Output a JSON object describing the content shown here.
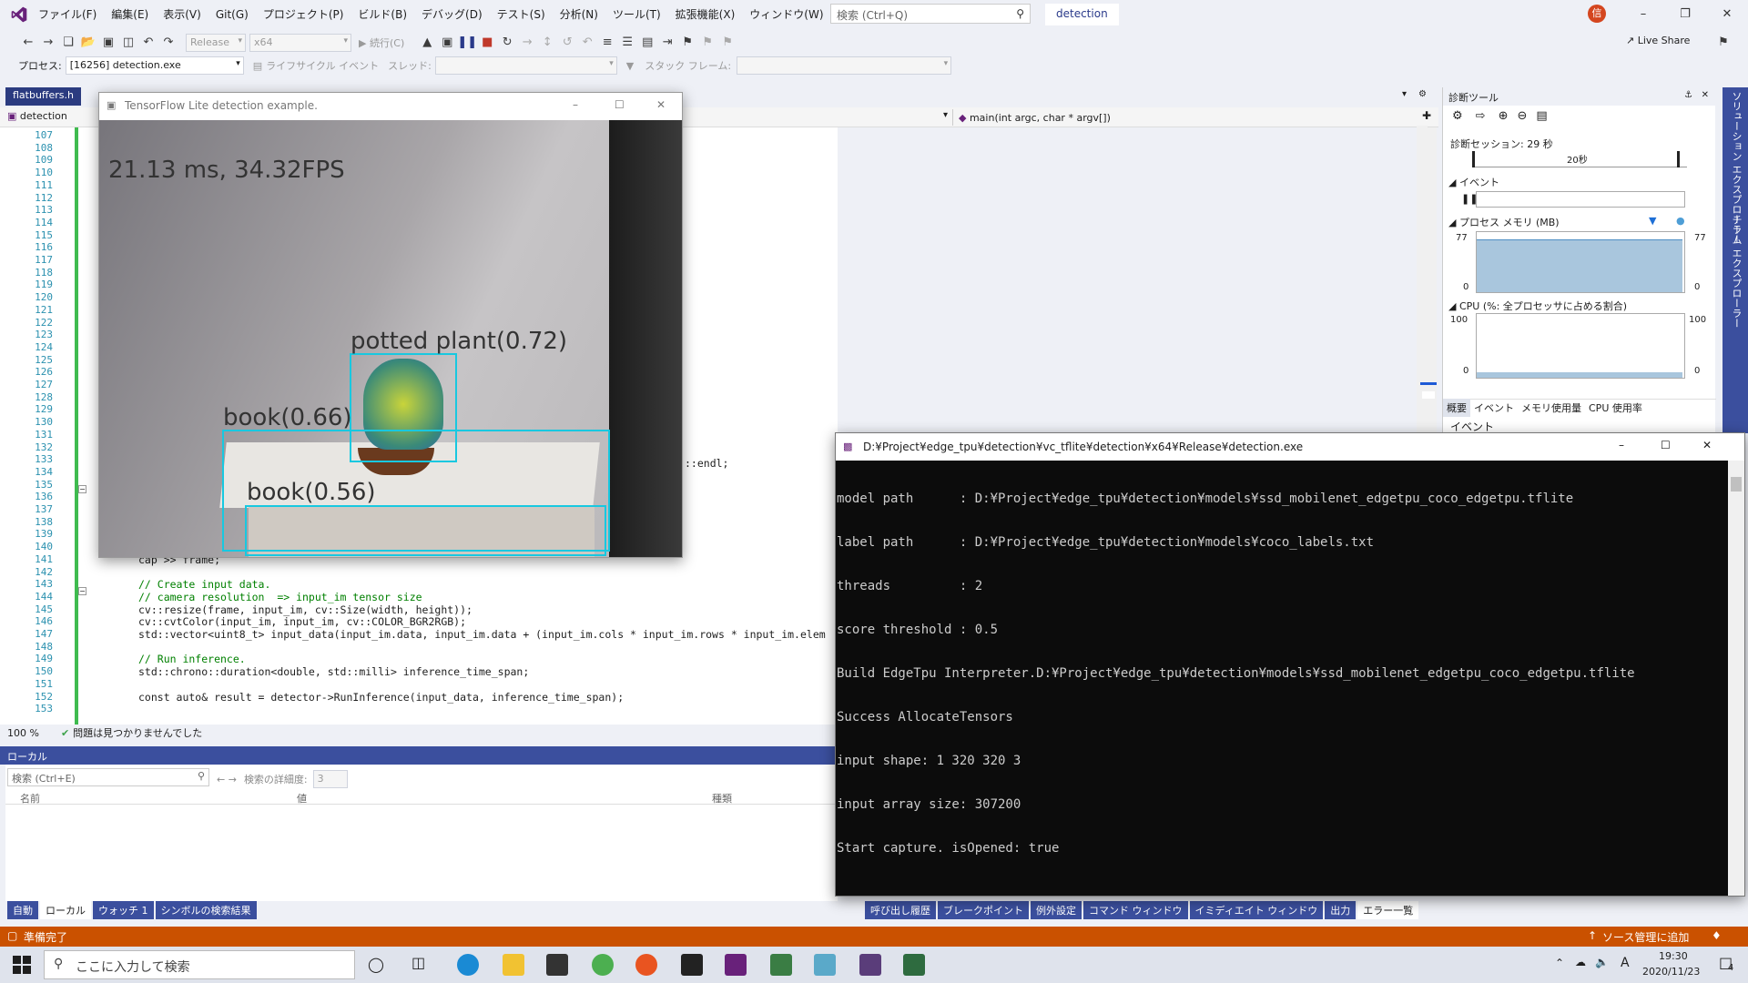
{
  "menubar": {
    "items": [
      "ファイル(F)",
      "編集(E)",
      "表示(V)",
      "Git(G)",
      "プロジェクト(P)",
      "ビルド(B)",
      "デバッグ(D)",
      "テスト(S)",
      "分析(N)",
      "ツール(T)",
      "拡張機能(X)",
      "ウィンドウ(W)",
      "ヘルプ(H)"
    ],
    "search_placeholder": "検索 (Ctrl+Q)",
    "solution_name": "detection",
    "avatar_initial": "信"
  },
  "toolbar": {
    "config": "Release",
    "platform": "x64",
    "continue_label": "続行(C)",
    "live_share": "Live Share"
  },
  "toolbar2": {
    "process_label": "プロセス:",
    "process_value": "[16256] detection.exe",
    "lifecycle_label": "ライフサイクル イベント",
    "thread_label": "スレッド:",
    "stackframe_label": "スタック フレーム:"
  },
  "editor": {
    "tab_name": "flatbuffers.h",
    "nav_project": "detection",
    "nav_function": "main(int argc, char * argv[])",
    "zoom": "100 %",
    "status_text": "問題は見つかりませんでした",
    "line_numbers": [
      "107",
      "108",
      "109",
      "110",
      "111",
      "112",
      "113",
      "114",
      "115",
      "116",
      "117",
      "118",
      "119",
      "120",
      "121",
      "122",
      "123",
      "124",
      "125",
      "126",
      "127",
      "128",
      "129",
      "130",
      "131",
      "132",
      "133",
      "134",
      "135",
      "136",
      "137",
      "138",
      "139",
      "140",
      "141",
      "142",
      "143",
      "144",
      "145",
      "146",
      "147",
      "148",
      "149",
      "150",
      "151",
      "152",
      "153"
    ],
    "code_endl": "::endl;",
    "code_lines": [
      {
        "line": "141",
        "text": "cap >> frame;"
      },
      {
        "line": "143",
        "text": "// Create input data."
      },
      {
        "line": "144",
        "text": "// camera resolution  => input_im tensor size"
      },
      {
        "line": "145",
        "text": "cv::resize(frame, input_im, cv::Size(width, height));"
      },
      {
        "line": "146",
        "text": "cv::cvtColor(input_im, input_im, cv::COLOR_BGR2RGB);"
      },
      {
        "line": "147",
        "text": "std::vector<uint8_t> input_data(input_im.data, input_im.data + (input_im.cols * input_im.rows * input_im.elem"
      },
      {
        "line": "149",
        "text": "// Run inference."
      },
      {
        "line": "150",
        "text": "std::chrono::duration<double, std::milli> inference_time_span;"
      },
      {
        "line": "152",
        "text": "const auto& result = detector->RunInference(input_data, inference_time_span);"
      }
    ]
  },
  "locals": {
    "title": "ローカル",
    "search_placeholder": "検索 (Ctrl+E)",
    "depth_label": "検索の詳細度:",
    "depth_value": "3",
    "columns": [
      "名前",
      "値",
      "種類"
    ],
    "tabs": [
      "自動",
      "ローカル",
      "ウォッチ 1",
      "シンボルの検索結果"
    ]
  },
  "bottom_tool_tabs": [
    "呼び出し履歴",
    "ブレークポイント",
    "例外設定",
    "コマンド ウィンドウ",
    "イミディエイト ウィンドウ",
    "出力",
    "エラー一覧"
  ],
  "diag": {
    "title": "診断ツール",
    "session": "診断セッション: 29 秒",
    "timeline_tick": "20秒",
    "events_label": "イベント",
    "memory_label": "プロセス メモリ (MB)",
    "memory_max": "77",
    "memory_min": "0",
    "cpu_label": "CPU (%: 全プロセッサに占める割合)",
    "cpu_max": "100",
    "cpu_min": "0",
    "tabs": [
      "概要",
      "イベント",
      "メモリ使用量",
      "CPU 使用率"
    ],
    "events_heading": "イベント"
  },
  "vertical_tabs": [
    "ソリューション エクスプローラー",
    "チーム エクスプローラー"
  ],
  "tf_window": {
    "title": "TensorFlow Lite detection example.",
    "fps_text": "21.13 ms, 34.32FPS",
    "detections": [
      {
        "label": "potted plant(0.72)"
      },
      {
        "label": "book(0.66)"
      },
      {
        "label": "book(0.56)"
      }
    ]
  },
  "console": {
    "title": "D:¥Project¥edge_tpu¥detection¥vc_tflite¥detection¥x64¥Release¥detection.exe",
    "lines": [
      "model path      : D:¥Project¥edge_tpu¥detection¥models¥ssd_mobilenet_edgetpu_coco_edgetpu.tflite",
      "label path      : D:¥Project¥edge_tpu¥detection¥models¥coco_labels.txt",
      "threads         : 2",
      "score threshold : 0.5",
      "Build EdgeTpu Interpreter.D:¥Project¥edge_tpu¥detection¥models¥ssd_mobilenet_edgetpu_coco_edgetpu.tflite",
      "Success AllocateTensors",
      "input shape: 1 320 320 3",
      "input array size: 307200",
      "Start capture. isOpened: true"
    ]
  },
  "statusbar": {
    "left": "準備完了",
    "right": "ソース管理に追加"
  },
  "taskbar": {
    "search_placeholder": "ここに入力して検索",
    "time": "19:30",
    "date": "2020/11/23",
    "ime": "A",
    "notif_count": "4"
  },
  "colors": {
    "vs_purple": "#68217a",
    "accent_blue": "#3b4f9e",
    "statusbar": "#ca5100",
    "detection_box": "#18c8e0"
  }
}
